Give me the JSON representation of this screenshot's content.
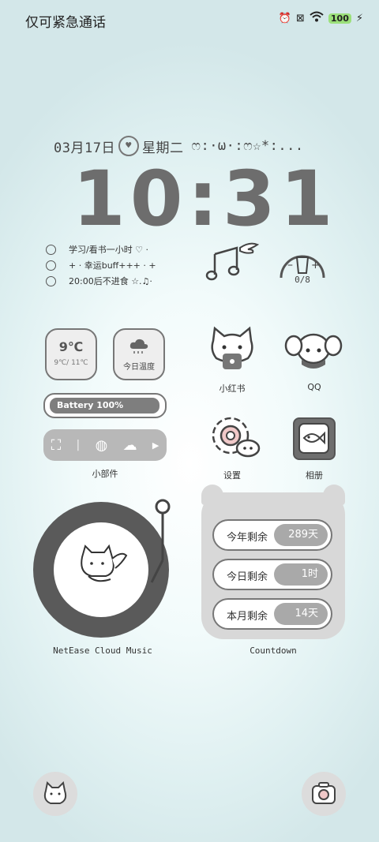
{
  "status_bar": {
    "title": "仅可紧急通话",
    "battery_level": "100",
    "icons": [
      "alarm-icon",
      "sim-icon",
      "wifi-icon",
      "battery-icon",
      "charging-icon"
    ]
  },
  "date": {
    "day": "03月17日",
    "weekday": "星期二",
    "kaomoji": "ෆ:·ω·:ෆ☆*:..."
  },
  "clock": {
    "time": "10:31"
  },
  "todo": [
    {
      "text": "学习/看书一小时 ♡  ·"
    },
    {
      "text": "+ · 幸运buff+++ ·  +"
    },
    {
      "text": "20:00后不进食 ☆.♫·"
    }
  ],
  "water": {
    "count": "0/8"
  },
  "weather": {
    "temp": "9℃",
    "range": "9℃/ 11℃",
    "label": "今日温度"
  },
  "battery_widget": {
    "label": "Battery 100%",
    "level_percent": 100
  },
  "widget_group_label": "小部件",
  "apps": [
    {
      "label": "小红书"
    },
    {
      "label": "QQ"
    },
    {
      "label": "设置"
    },
    {
      "label": "相册"
    }
  ],
  "music": {
    "label": "NetEase Cloud Music"
  },
  "countdown": {
    "label": "Countdown",
    "rows": [
      {
        "label": "今年剩余",
        "value": "289天"
      },
      {
        "label": "今日剩余",
        "value": "1时"
      },
      {
        "label": "本月剩余",
        "value": "14天"
      }
    ]
  },
  "colors": {
    "accent_gray": "#777777",
    "battery_badge": "#9be07a"
  }
}
